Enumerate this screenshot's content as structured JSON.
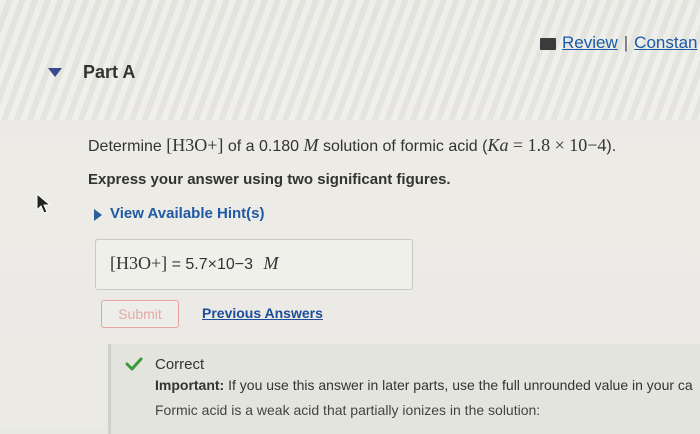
{
  "header": {
    "review_label": "Review",
    "separator": "|",
    "constants_label": "Constan"
  },
  "part": {
    "title": "Part A"
  },
  "question": {
    "prefix": "Determine",
    "species": "[H3O+]",
    "mid1": "of a 0.180",
    "unit": "M",
    "mid2": "solution of formic acid (",
    "ka_symbol": "Ka",
    "ka_value": "= 1.8 × 10−4",
    "suffix": ")."
  },
  "instruction": "Express your answer using two significant figures.",
  "hint": {
    "label": "View Available Hint(s)"
  },
  "answer": {
    "lhs": "[H3O+]",
    "equals": "=",
    "value": "5.7×10−3",
    "unit": "M"
  },
  "actions": {
    "submit_label": "Submit",
    "previous_label": "Previous Answers"
  },
  "feedback": {
    "title": "Correct",
    "important_label": "Important:",
    "important_text": " If you use this answer in later parts, use the full unrounded value in your ca",
    "body": "Formic acid is a weak acid that partially ionizes in the solution:"
  },
  "colors": {
    "link": "#1a5aa6",
    "check": "#3a9a3a",
    "submit_border": "#e7a4a0"
  }
}
